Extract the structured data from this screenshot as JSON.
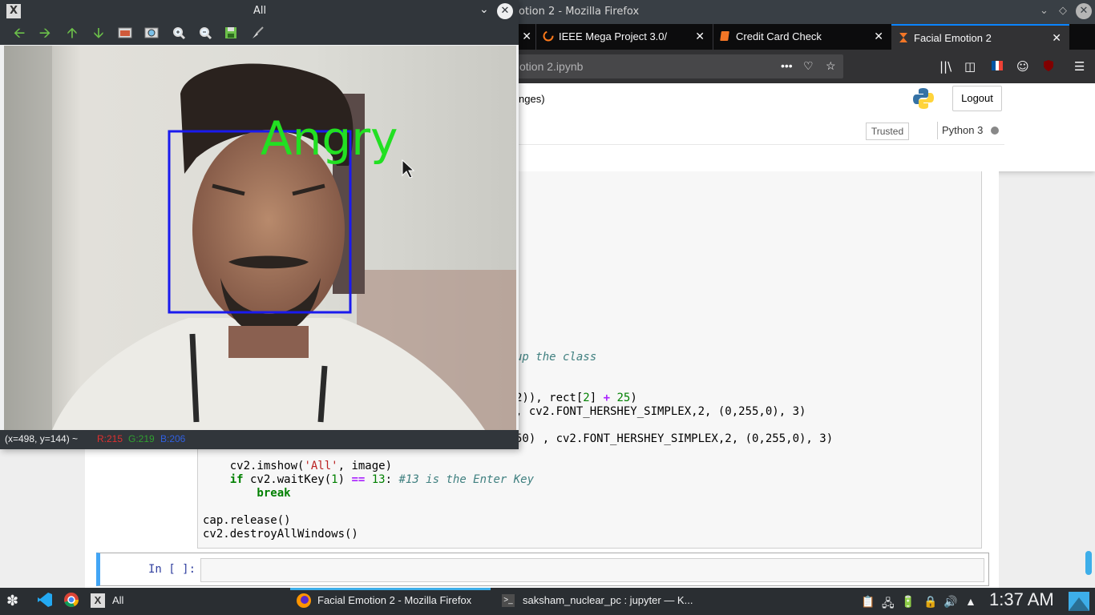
{
  "firefox": {
    "window_title": "otion 2 - Mozilla Firefox",
    "tabs": [
      {
        "label": "IEEE Mega Project 3.0/",
        "close": "✕"
      },
      {
        "label": "Credit Card Check",
        "close": "✕"
      },
      {
        "label": "Facial Emotion 2",
        "close": "✕"
      }
    ],
    "new_tab": "+",
    "url": "otion 2.ipynb",
    "page_actions": "•••"
  },
  "jupyter": {
    "changes_text": "nges)",
    "logout_label": "Logout",
    "trusted_label": "Trusted",
    "kernel_label": "Python 3",
    "prompt_empty": "In [ ]:",
    "code_lines": {
      "l1": "up the class",
      "l2a": "2)), rect[",
      "l2b": "2",
      "l2c": "] ",
      "l2d": "+",
      "l2e": " ",
      "l2f": "25",
      "l2g": ")",
      "l3": ", cv2.FONT_HERSHEY_SIMPLEX,2, (0,255,0), 3)",
      "l4": "50) , cv2.FONT_HERSHEY_SIMPLEX,2, (0,255,0), 3)",
      "l5a": "    cv2.imshow(",
      "l5b": "'All'",
      "l5c": ", image)",
      "l6a": "    if",
      "l6b": " cv2.waitKey(",
      "l6c": "1",
      "l6d": ") ",
      "l6e": "==",
      "l6f": " ",
      "l6g": "13",
      "l6h": ": ",
      "l6i": "#13 is the Enter Key",
      "l7": "        break",
      "l8": "cap.release()",
      "l9": "cv2.destroyAllWindows()"
    }
  },
  "cv_window": {
    "title": "All",
    "emotion_label": "Angry",
    "status": {
      "coords": "(x=498, y=144) ~",
      "r": "R:215",
      "g": "G:219",
      "b": "B:206"
    }
  },
  "taskbar": {
    "items": [
      "All",
      "Facial Emotion 2 - Mozilla Firefox",
      "saksham_nuclear_pc : jupyter — K..."
    ],
    "clock": "1:37 AM"
  },
  "colors": {
    "accent": "#3daee9",
    "label_green": "#22e022",
    "face_box": "#1a1aee"
  }
}
